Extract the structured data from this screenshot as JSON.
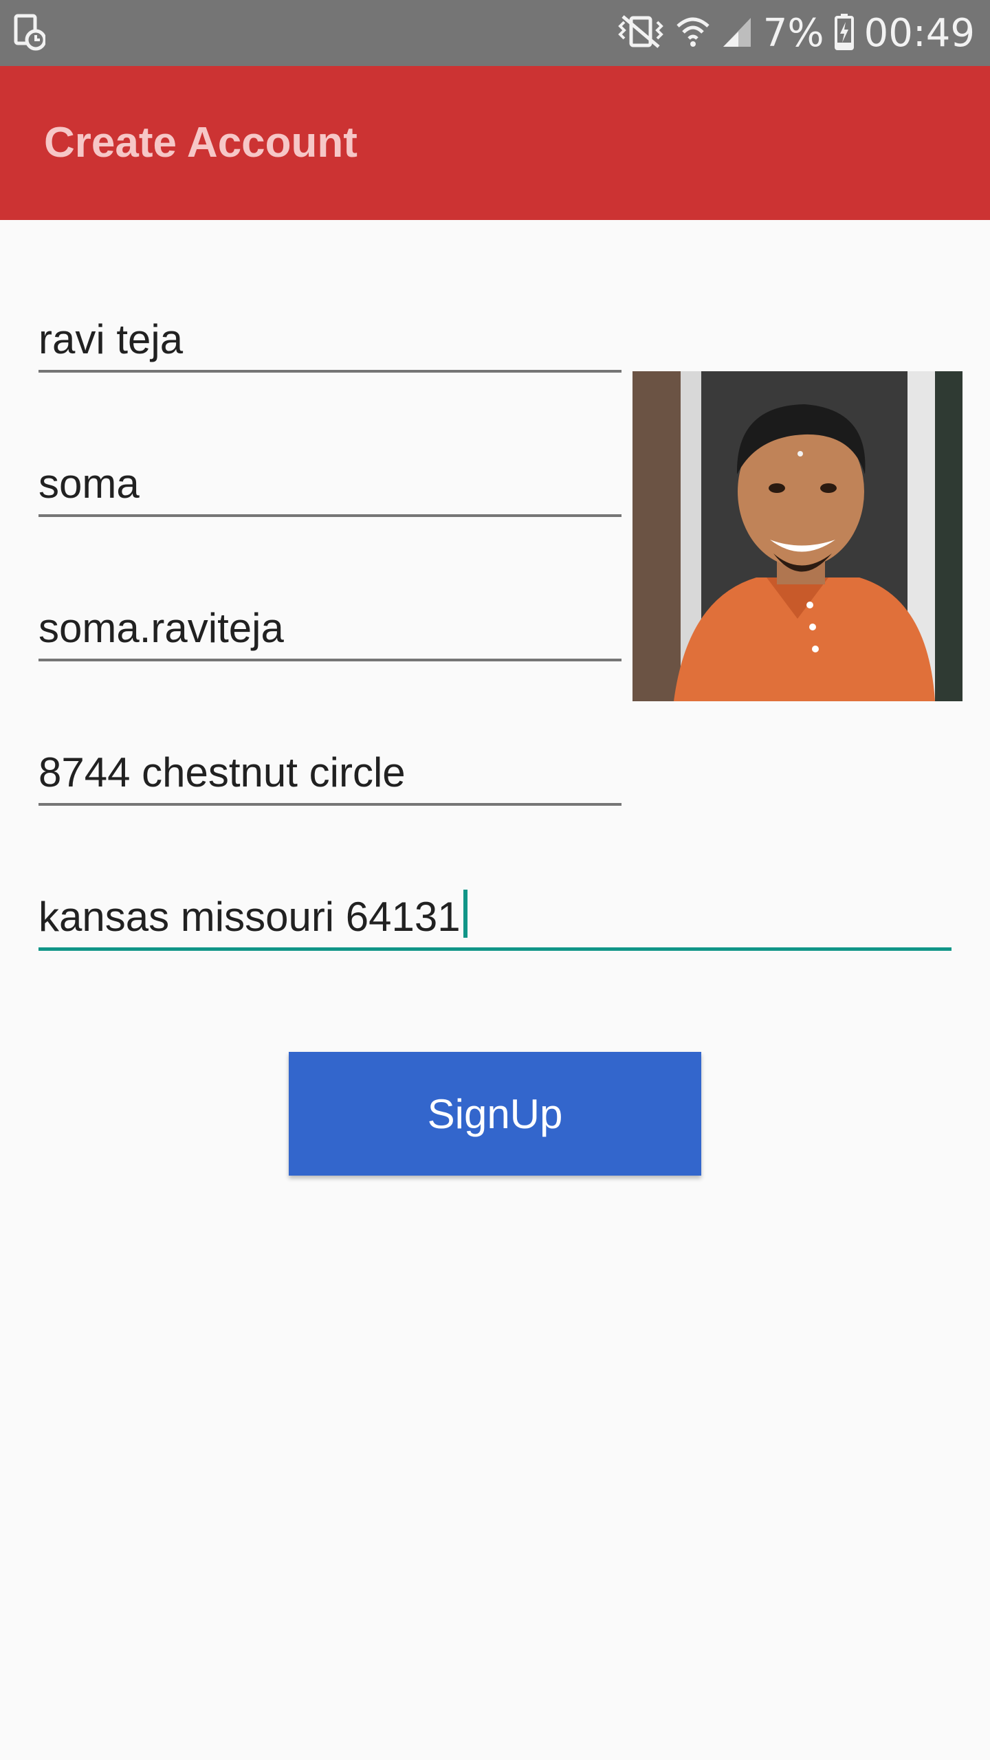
{
  "status_bar": {
    "battery": "7%",
    "time": "00:49",
    "icons": [
      "screenshot-icon",
      "vibrate-icon",
      "wifi-icon",
      "signal-icon",
      "battery-charging-icon"
    ]
  },
  "app_bar": {
    "title": "Create Account",
    "color": "#cc3333"
  },
  "form": {
    "fields": [
      {
        "value": "ravi teja"
      },
      {
        "value": "soma"
      },
      {
        "value": "soma.raviteja"
      },
      {
        "value": "8744 chestnut circle"
      },
      {
        "value": "kansas missouri 64131"
      }
    ],
    "focus_color": "#119688",
    "signup_label": "SignUp",
    "signup_color": "#3366cc"
  },
  "profile_photo": {
    "icon": "profile-photo"
  }
}
